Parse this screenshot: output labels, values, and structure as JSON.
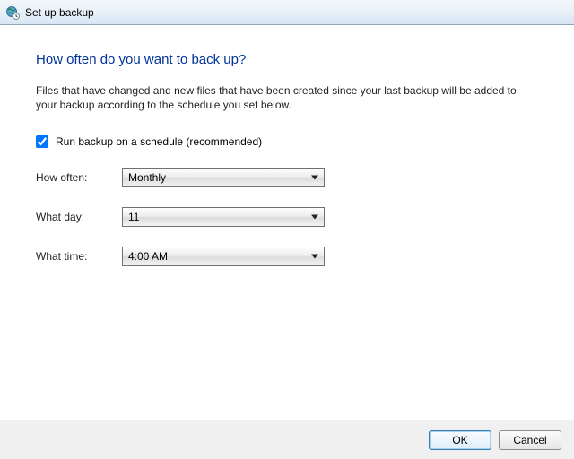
{
  "window": {
    "title": "Set up backup"
  },
  "page": {
    "heading": "How often do you want to back up?",
    "description": "Files that have changed and new files that have been created since your last backup will be added to your backup according to the schedule you set below."
  },
  "schedule": {
    "run_on_schedule_label": "Run backup on a schedule (recommended)",
    "run_on_schedule_checked": true,
    "fields": {
      "how_often": {
        "label": "How often:",
        "value": "Monthly"
      },
      "what_day": {
        "label": "What day:",
        "value": "11"
      },
      "what_time": {
        "label": "What time:",
        "value": "4:00 AM"
      }
    }
  },
  "buttons": {
    "ok": "OK",
    "cancel": "Cancel"
  },
  "icons": {
    "world": "world-clock-icon"
  }
}
